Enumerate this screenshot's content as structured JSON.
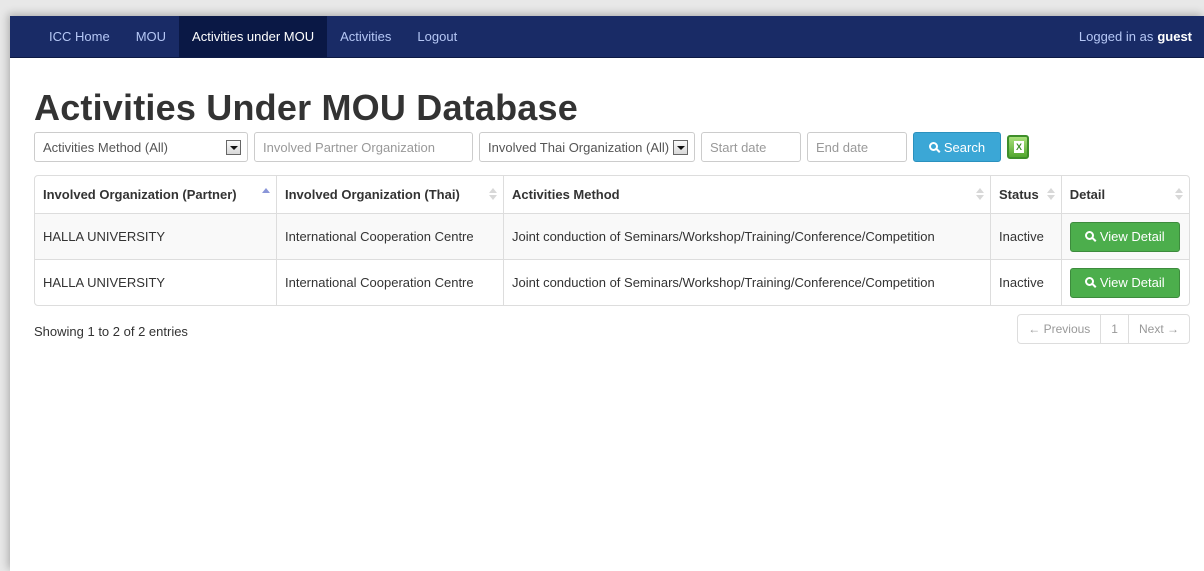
{
  "navbar": {
    "items": [
      {
        "label": "ICC Home"
      },
      {
        "label": "MOU"
      },
      {
        "label": "Activities under MOU",
        "active": true
      },
      {
        "label": "Activities"
      },
      {
        "label": "Logout"
      }
    ],
    "logged_in_prefix": "Logged in as",
    "user": "guest"
  },
  "page_title": "Activities Under MOU Database",
  "filters": {
    "method_select": "Activities Method (All)",
    "partner_placeholder": "Involved Partner Organization",
    "thai_select": "Involved Thai Organization (All)",
    "start_placeholder": "Start date",
    "end_placeholder": "End date",
    "search_label": "Search"
  },
  "table": {
    "headers": [
      "Involved Organization (Partner)",
      "Involved Organization (Thai)",
      "Activities Method",
      "Status",
      "Detail"
    ],
    "rows": [
      {
        "partner": "HALLA UNIVERSITY",
        "thai": "International Cooperation Centre",
        "method": "Joint conduction of Seminars/Workshop/Training/Conference/Competition",
        "status": "Inactive",
        "action": "View Detail"
      },
      {
        "partner": "HALLA UNIVERSITY",
        "thai": "International Cooperation Centre",
        "method": "Joint conduction of Seminars/Workshop/Training/Conference/Competition",
        "status": "Inactive",
        "action": "View Detail"
      }
    ]
  },
  "footer": {
    "info": "Showing 1 to 2 of 2 entries",
    "prev": "← Previous",
    "page": "1",
    "next": "Next →"
  },
  "colors": {
    "navbar": "#192b66",
    "search_button": "#3ba7d6",
    "view_button": "#4cae4c"
  }
}
